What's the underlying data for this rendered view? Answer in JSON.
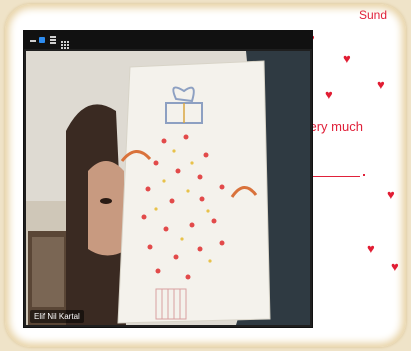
{
  "document": {
    "partial_word": "Sund",
    "fragment_y": "y",
    "phrase": "very much",
    "period": ".",
    "heart_color": "#e11d33"
  },
  "video_call": {
    "participant_name": "Elif Nil Kartal",
    "toolbar_icons": [
      "minimize-icon",
      "camera-active-icon",
      "layout-icon",
      "grid-icon"
    ]
  },
  "drawing": {
    "description_colors": {
      "gift_box": "#8da0c2",
      "hearts": "#e24a4a",
      "rainbow": "#d9723b"
    }
  }
}
